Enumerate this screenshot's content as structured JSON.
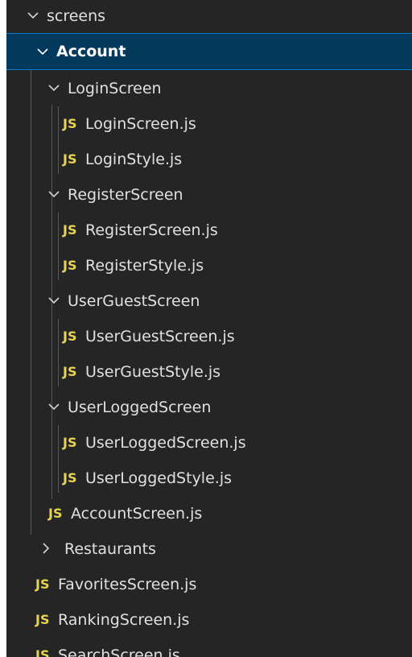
{
  "explorer": {
    "colors": {
      "background": "#252526",
      "selected_background": "#04395e",
      "selected_border": "#007fd4",
      "js_icon": "#e8d44d",
      "text": "#e0e0e0"
    },
    "icons": {
      "expanded": "chevron-down-icon",
      "collapsed": "chevron-right-icon",
      "js_file": "js-file-icon"
    },
    "js_badge": "JS",
    "items": [
      {
        "label": "screens",
        "type": "folder",
        "expanded": true
      },
      {
        "label": "Account",
        "type": "folder",
        "expanded": true,
        "selected": true
      },
      {
        "label": "LoginScreen",
        "type": "folder",
        "expanded": true
      },
      {
        "label": "LoginScreen.js",
        "type": "file"
      },
      {
        "label": "LoginStyle.js",
        "type": "file"
      },
      {
        "label": "RegisterScreen",
        "type": "folder",
        "expanded": true
      },
      {
        "label": "RegisterScreen.js",
        "type": "file"
      },
      {
        "label": "RegisterStyle.js",
        "type": "file"
      },
      {
        "label": "UserGuestScreen",
        "type": "folder",
        "expanded": true
      },
      {
        "label": "UserGuestScreen.js",
        "type": "file"
      },
      {
        "label": "UserGuestStyle.js",
        "type": "file"
      },
      {
        "label": "UserLoggedScreen",
        "type": "folder",
        "expanded": true
      },
      {
        "label": "UserLoggedScreen.js",
        "type": "file"
      },
      {
        "label": "UserLoggedStyle.js",
        "type": "file"
      },
      {
        "label": "AccountScreen.js",
        "type": "file"
      },
      {
        "label": "Restaurants",
        "type": "folder",
        "expanded": false
      },
      {
        "label": "FavoritesScreen.js",
        "type": "file"
      },
      {
        "label": "RankingScreen.js",
        "type": "file"
      },
      {
        "label": "SearchScreen.js",
        "type": "file"
      }
    ]
  }
}
